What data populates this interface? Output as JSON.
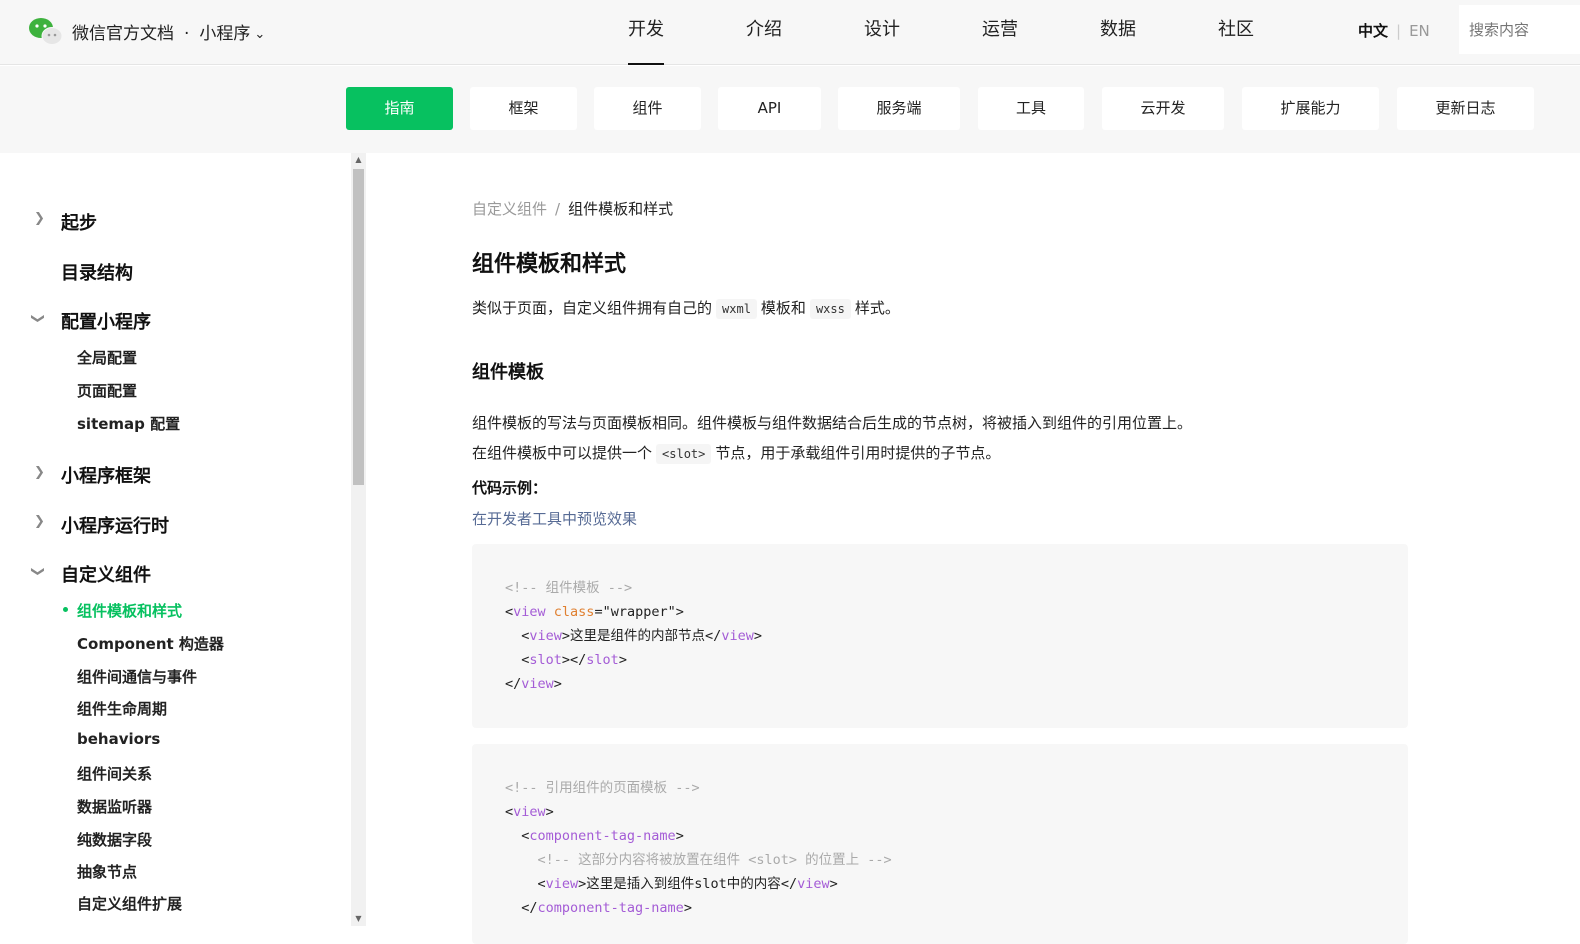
{
  "colors": {
    "accent": "#07c160",
    "link": "#576b95",
    "tag": "#a45cd6",
    "attr": "#e08031",
    "comment": "#aaaaaa"
  },
  "header": {
    "brand": "微信官方文档",
    "separator": "·",
    "product": "小程序",
    "nav": [
      "开发",
      "介绍",
      "设计",
      "运营",
      "数据",
      "社区"
    ],
    "active_nav": "开发",
    "lang_zh": "中文",
    "lang_en": "EN",
    "search_placeholder": "搜索内容"
  },
  "subnav": [
    "指南",
    "框架",
    "组件",
    "API",
    "服务端",
    "工具",
    "云开发",
    "扩展能力",
    "更新日志"
  ],
  "sidebar": {
    "top": [
      "起步",
      "目录结构",
      "配置小程序",
      "小程序框架",
      "小程序运行时",
      "自定义组件"
    ],
    "config_children": [
      "全局配置",
      "页面配置",
      "sitemap 配置"
    ],
    "component_children": [
      "组件模板和样式",
      "Component 构造器",
      "组件间通信与事件",
      "组件生命周期",
      "behaviors",
      "组件间关系",
      "数据监听器",
      "纯数据字段",
      "抽象节点",
      "自定义组件扩展"
    ],
    "active": "组件模板和样式"
  },
  "content": {
    "breadcrumb_parent": "自定义组件",
    "breadcrumb_sep": "/",
    "breadcrumb_current": "组件模板和样式",
    "title": "组件模板和样式",
    "intro_a": "类似于页面，自定义组件拥有自己的",
    "intro_code1": "wxml",
    "intro_b": "模板和",
    "intro_code2": "wxss",
    "intro_c": "样式。",
    "section_title": "组件模板",
    "para1": "组件模板的写法与页面模板相同。组件模板与组件数据结合后生成的节点树，将被插入到组件的引用位置上。",
    "para2_a": "在组件模板中可以提供一个",
    "para2_code": "<slot>",
    "para2_b": "节点，用于承载组件引用时提供的子节点。",
    "example_label": "代码示例：",
    "preview_link": "在开发者工具中预览效果",
    "code1": {
      "comment": "<!-- 组件模板 -->",
      "view": "view",
      "class_attr": "class",
      "class_value": "\"wrapper\"",
      "inner_text": "这里是组件的内部节点",
      "slot": "slot"
    },
    "code2": {
      "comment": "<!-- 引用组件的页面模板 -->",
      "view": "view",
      "component": "component-tag-name",
      "inner_comment": "<!-- 这部分内容将被放置在组件 <slot> 的位置上 -->",
      "inner_text": "这里是插入到组件slot中的内容"
    }
  }
}
